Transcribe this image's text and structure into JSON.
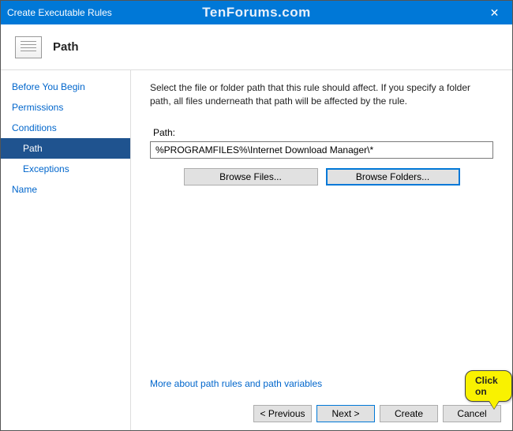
{
  "titlebar": {
    "title": "Create Executable Rules",
    "watermark": "TenForums.com"
  },
  "header": {
    "title": "Path"
  },
  "sidebar": {
    "items": [
      {
        "label": "Before You Begin",
        "class": "link"
      },
      {
        "label": "Permissions",
        "class": "link"
      },
      {
        "label": "Conditions",
        "class": "link"
      },
      {
        "label": "Path",
        "class": "selected"
      },
      {
        "label": "Exceptions",
        "class": "sub link"
      },
      {
        "label": "Name",
        "class": "link"
      }
    ]
  },
  "main": {
    "instructions": "Select the file or folder path that this rule should affect. If you specify a folder path, all files underneath that path will be affected by the rule.",
    "path_label": "Path:",
    "path_value": "%PROGRAMFILES%\\Internet Download Manager\\*",
    "browse_files": "Browse Files...",
    "browse_folders": "Browse Folders...",
    "more_link": "More about path rules and path variables"
  },
  "footer": {
    "previous": "< Previous",
    "next": "Next >",
    "create": "Create",
    "cancel": "Cancel"
  },
  "callout": {
    "text": "Click on"
  }
}
